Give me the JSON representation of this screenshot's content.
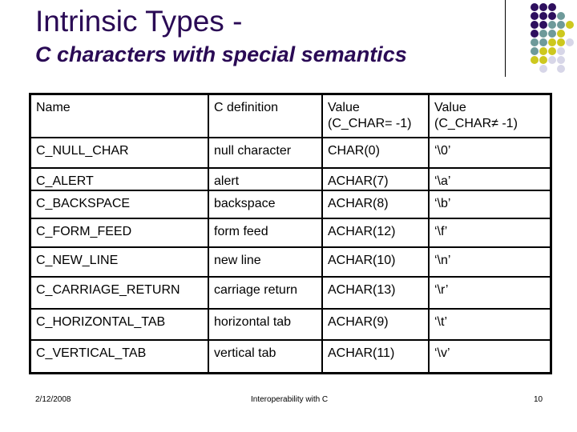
{
  "slide": {
    "title": "Intrinsic Types -",
    "subtitle": "C characters with special semantics"
  },
  "decoration": {
    "dot_colors": {
      "purple": "#2e0f5e",
      "teal": "#6e9a9a",
      "yellow": "#cdc81e",
      "lavender": "#d7d6e8"
    },
    "dot_pattern": [
      [
        "purple",
        "purple",
        "purple",
        null,
        null
      ],
      [
        "purple",
        "purple",
        "purple",
        "teal",
        null
      ],
      [
        "purple",
        "purple",
        "teal",
        "teal",
        "yellow"
      ],
      [
        "purple",
        "teal",
        "teal",
        "yellow",
        null
      ],
      [
        "teal",
        "teal",
        "yellow",
        "yellow",
        "lavender"
      ],
      [
        "teal",
        "yellow",
        "yellow",
        "lavender",
        null
      ],
      [
        "yellow",
        "yellow",
        "lavender",
        "lavender",
        null
      ],
      [
        null,
        "lavender",
        null,
        "lavender",
        null
      ]
    ]
  },
  "table": {
    "headers": [
      "Name",
      "C definition",
      "Value\n(C_CHAR= -1)",
      "Value\n(C_CHAR≠ -1)"
    ],
    "header_lines": [
      [
        "Name"
      ],
      [
        "C definition"
      ],
      [
        "Value",
        "(C_CHAR= -1)"
      ],
      [
        "Value",
        "(C_CHAR≠ -1)"
      ]
    ],
    "rows": [
      [
        "C_NULL_CHAR",
        "null character",
        "CHAR(0)",
        "‘\\0’"
      ],
      [
        "C_ALERT",
        "alert",
        "ACHAR(7)",
        "‘\\a’"
      ],
      [
        "C_BACKSPACE",
        "backspace",
        "ACHAR(8)",
        "‘\\b’"
      ],
      [
        "C_FORM_FEED",
        "form feed",
        "ACHAR(12)",
        "‘\\f’"
      ],
      [
        "C_NEW_LINE",
        "new line",
        "ACHAR(10)",
        "‘\\n’"
      ],
      [
        "C_CARRIAGE_RETURN",
        "carriage return",
        "ACHAR(13)",
        "‘\\r’"
      ],
      [
        "C_HORIZONTAL_TAB",
        "horizontal tab",
        "ACHAR(9)",
        "‘\\t’"
      ],
      [
        "C_VERTICAL_TAB",
        "vertical tab",
        "ACHAR(11)",
        "‘\\v’"
      ]
    ]
  },
  "footer": {
    "date": "2/12/2008",
    "center": "Interoperability with C",
    "page": "10"
  }
}
